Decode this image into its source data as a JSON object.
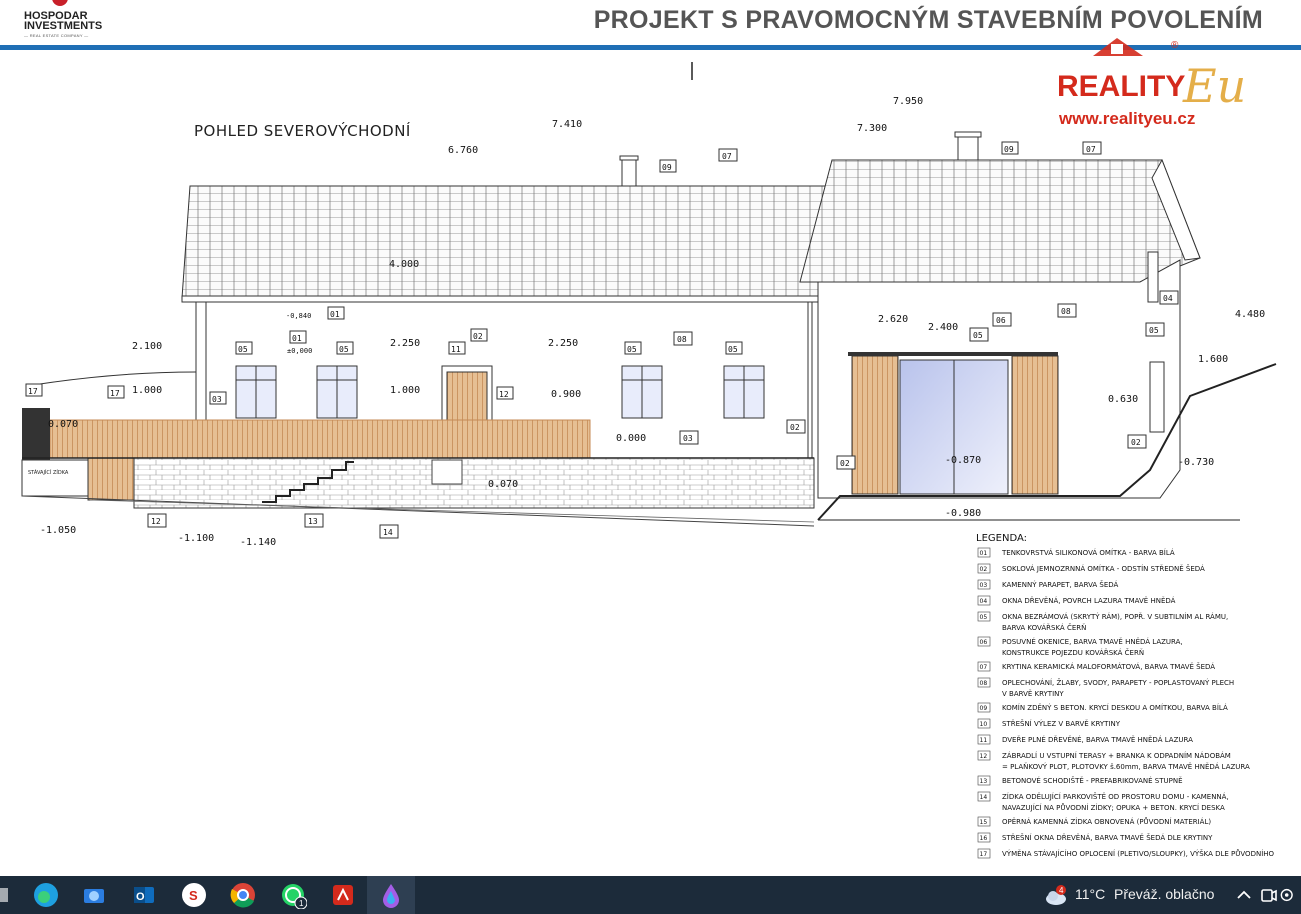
{
  "header": {
    "logo_line1": "HOSPODAR",
    "logo_line2": "INVESTMENTS",
    "logo_tagline": "— REAL ESTATE COMPANY —",
    "title": "PROJEKT S PRAVOMOCNÝM STAVEBNÍM POVOLENÍM"
  },
  "watermark": {
    "brand": "REALITY",
    "script": "Eu",
    "url": "www.realityeu.cz",
    "registered": "®"
  },
  "drawing": {
    "view_title": "POHLED SEVEROVÝCHODNÍ",
    "existing_wall_label": "STÁVAJÍCÍ ZÍDKA",
    "levels": [
      "7.410",
      "6.760",
      "7.950",
      "7.300",
      "4.000",
      "4.480",
      "2.100",
      "1.000",
      "2.250",
      "1.000",
      "0.900",
      "2.250",
      "0.000",
      "0.070",
      "0.070",
      "2.620",
      "2.400",
      "1.600",
      "0.630",
      "-0.730",
      "-0.870",
      "-0.980",
      "-1.050",
      "-1.100",
      "-1.140",
      "-0,840",
      "±0,000"
    ],
    "markers": [
      "01",
      "02",
      "03",
      "04",
      "05",
      "06",
      "07",
      "08",
      "09",
      "11",
      "12",
      "13",
      "14",
      "15",
      "17"
    ]
  },
  "legend": {
    "title": "LEGENDA:",
    "items": [
      {
        "code": "01",
        "lines": [
          "TENKOVRSTVÁ SILIKONOVÁ OMÍTKA - BARVA BÍLÁ"
        ]
      },
      {
        "code": "02",
        "lines": [
          "SOKLOVÁ JEMNOZRNNÁ OMÍTKA - ODSTÍN STŘEDNĚ ŠEDÁ"
        ]
      },
      {
        "code": "03",
        "lines": [
          "KAMENNÝ PARAPET, BARVA ŠEDÁ"
        ]
      },
      {
        "code": "04",
        "lines": [
          "OKNA DŘEVĚNÁ, POVRCH LAZURA TMAVĚ HNĚDÁ"
        ]
      },
      {
        "code": "05",
        "lines": [
          "OKNA BEZRÁMOVÁ (SKRYTÝ RÁM), POPŘ. V SUBTILNÍM AL RÁMU,",
          "BARVA KOVÁŘSKÁ ČERŇ"
        ]
      },
      {
        "code": "06",
        "lines": [
          "POSUVNÉ OKENICE, BARVA TMAVĚ HNĚDÁ LAZURA,",
          "KONSTRUKCE POJEZDU KOVÁŘSKÁ ČERŇ"
        ]
      },
      {
        "code": "07",
        "lines": [
          "KRYTINA KERAMICKÁ MALOFORMÁTOVÁ, BARVA TMAVĚ ŠEDÁ"
        ]
      },
      {
        "code": "08",
        "lines": [
          "OPLECHOVÁNÍ, ŽLABY, SVODY, PARAPETY - POPLASTOVANÝ PLECH",
          "V BARVĚ KRYTINY"
        ]
      },
      {
        "code": "09",
        "lines": [
          "KOMÍN ZDĚNÝ S BETON. KRYCÍ DESKOU A OMÍTKOU, BARVA BÍLÁ"
        ]
      },
      {
        "code": "10",
        "lines": [
          "STŘEŠNÍ VÝLEZ V BARVĚ KRYTINY"
        ]
      },
      {
        "code": "11",
        "lines": [
          "DVEŘE PLNÉ DŘEVĚNÉ, BARVA TMAVĚ HNĚDÁ LAZURA"
        ]
      },
      {
        "code": "12",
        "lines": [
          "ZÁBRADLÍ U VSTUPNÍ TERASY + BRANKA K ODPADNÍM NÁDOBÁM",
          "= PLAŇKOVÝ PLOT, PLOTOVKY š.60mm, BARVA TMAVĚ HNĚDÁ LAZURA"
        ]
      },
      {
        "code": "13",
        "lines": [
          "BETONOVÉ SCHODIŠTĚ - PREFABRIKOVANÉ STUPNĚ"
        ]
      },
      {
        "code": "14",
        "lines": [
          "ZÍDKA ODĚLUJÍCÍ PARKOVIŠTĚ OD PROSTORU DOMU - KAMENNÁ,",
          "NAVAZUJÍCÍ NA PŮVODNÍ ZÍDKY; OPUKA + BETON. KRYCÍ DESKA"
        ]
      },
      {
        "code": "15",
        "lines": [
          "OPĚRNÁ KAMENNÁ ZÍDKA OBNOVENÁ (PŮVODNÍ MATERIÁL)"
        ]
      },
      {
        "code": "16",
        "lines": [
          "STŘEŠNÍ OKNA DŘEVĚNÁ, BARVA TMAVĚ ŠEDÁ DLE KRYTINY"
        ]
      },
      {
        "code": "17",
        "lines": [
          "VÝMĚNA STÁVAJÍCÍHO OPLOCENÍ (PLETIVO/SLOUPKY), VÝŠKA DLE PŮVODNÍHO"
        ]
      }
    ]
  },
  "taskbar": {
    "icons": [
      "start-icon",
      "edge-icon",
      "explorer-icon",
      "outlook-icon",
      "s-app-icon",
      "chrome-icon",
      "whatsapp-icon",
      "acrobat-icon",
      "paint-icon"
    ],
    "whatsapp_badge": "1",
    "weather_badge": "4",
    "temperature": "11°C",
    "weather": "Převáž. oblačno",
    "accent_color": "#1f6fb5"
  }
}
